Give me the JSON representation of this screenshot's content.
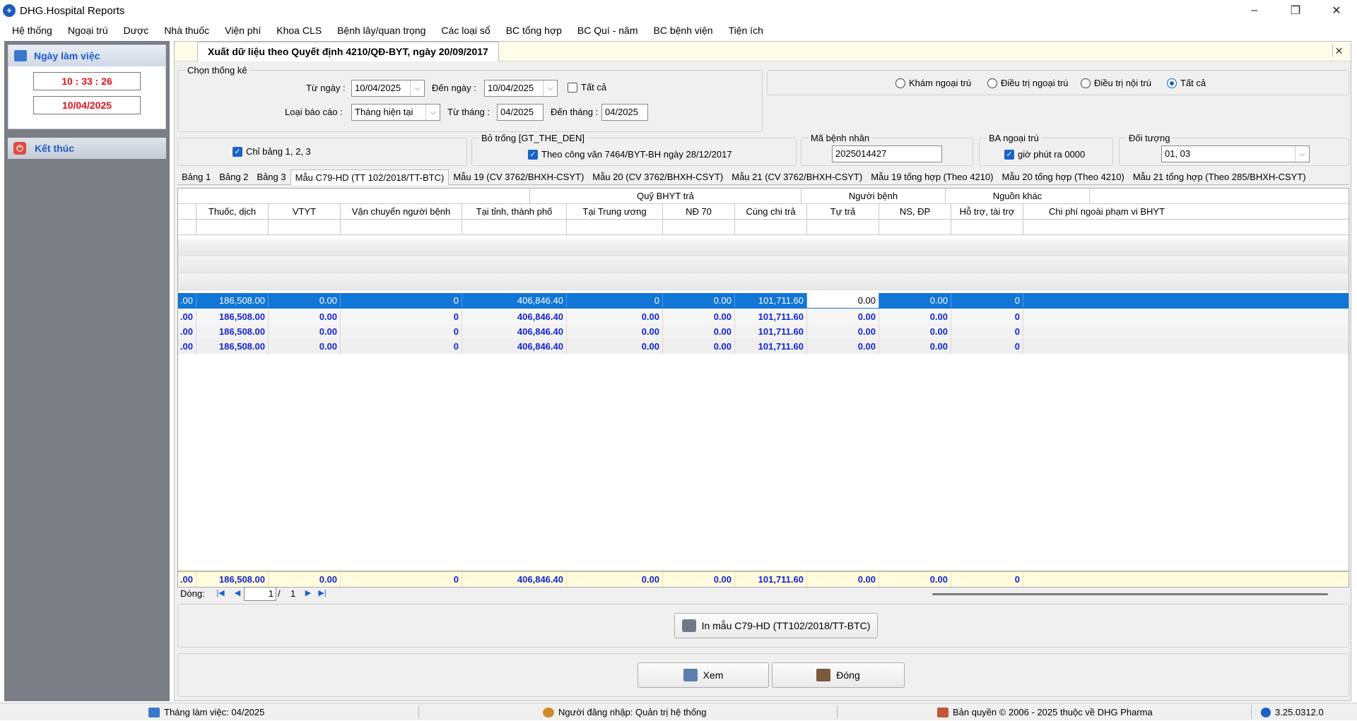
{
  "window": {
    "title": "DHG.Hospital Reports",
    "controls": [
      "–",
      "❐",
      "✕"
    ]
  },
  "menu": [
    "Hệ thống",
    "Ngoại trú",
    "Dược",
    "Nhà thuốc",
    "Viện phí",
    "Khoa CLS",
    "Bệnh lây/quan trọng",
    "Các loại sổ",
    "BC tổng hợp",
    "BC Quí - năm",
    "BC bệnh viện",
    "Tiện ích"
  ],
  "left": {
    "work_day_label": "Ngày làm việc",
    "time": "10 : 33 : 26",
    "date": "10/04/2025",
    "exit_label": "Kết thúc"
  },
  "doc": {
    "tab_title": "Xuất dữ liệu theo Quyết định 4210/QĐ-BYT, ngày 20/09/2017",
    "close": "✕"
  },
  "filters": {
    "group_label": "Chọn thống kê",
    "from_date_label": "Từ ngày :",
    "from_date": "10/04/2025",
    "to_date_label": "Đến ngày :",
    "to_date": "10/04/2025",
    "all_label": "Tất cả",
    "report_type_label": "Loại báo cáo :",
    "report_type": "Tháng hiện tại",
    "from_month_label": "Từ tháng :",
    "from_month": "04/2025",
    "to_month_label": "Đến tháng :",
    "to_month": "04/2025",
    "radios": [
      "Khám ngoại trú",
      "Điều trị ngoại trú",
      "Điều trị nội trú",
      "Tất cả"
    ],
    "only_tables_label": "Chỉ bảng 1, 2, 3",
    "blank_group_label": "Bỏ trống [GT_THE_DEN]",
    "blank_check_label": "Theo công văn 7464/BYT-BH ngày 28/12/2017",
    "patient_code_label": "Mã bệnh nhân",
    "patient_code": "2025014427",
    "ba_label": "BA ngoại trú",
    "ba_check_label": "giờ phút ra 0000",
    "object_label": "Đối tượng",
    "object_value": "01, 03"
  },
  "report_tabs": [
    "Bảng 1",
    "Bảng 2",
    "Bảng 3",
    "Mẫu C79-HD (TT 102/2018/TT-BTC)",
    "Mẫu 19 (CV 3762/BHXH-CSYT)",
    "Mẫu 20 (CV 3762/BHXH-CSYT)",
    "Mẫu 21 (CV 3762/BHXH-CSYT)",
    "Mẫu 19 tổng hợp (Theo 4210)",
    "Mẫu 20 tổng hợp (Theo 4210)",
    "Mẫu 21 tổng hợp (Theo 285/BHXH-CSYT)"
  ],
  "grid": {
    "group_headers": [
      "Quỹ BHYT trả",
      "Người bệnh",
      "Nguồn khác"
    ],
    "columns": [
      "Thuốc, dịch",
      "VTYT",
      "Vận chuyển người bệnh",
      "Tại tỉnh, thành phố",
      "Tại Trung ương",
      "NĐ 70",
      "Cùng chi trả",
      "Tự trả",
      "NS, ĐP",
      "Hỗ trợ, tài trợ",
      "Chi phí ngoài phạm vi BHYT"
    ],
    "selected_row": [
      ".00",
      "186,508.00",
      "0.00",
      "0",
      "406,846.40",
      "0",
      "0.00",
      "101,711.60",
      "0.00",
      "0.00",
      "0"
    ],
    "rows": [
      [
        ".00",
        "186,508.00",
        "0.00",
        "0",
        "406,846.40",
        "0.00",
        "0.00",
        "101,711.60",
        "0.00",
        "0.00",
        "0"
      ],
      [
        ".00",
        "186,508.00",
        "0.00",
        "0",
        "406,846.40",
        "0.00",
        "0.00",
        "101,711.60",
        "0.00",
        "0.00",
        "0"
      ],
      [
        ".00",
        "186,508.00",
        "0.00",
        "0",
        "406,846.40",
        "0.00",
        "0.00",
        "101,711.60",
        "0.00",
        "0.00",
        "0"
      ]
    ],
    "summary": [
      ".00",
      "186,508.00",
      "0.00",
      "0",
      "406,846.40",
      "0.00",
      "0.00",
      "101,711.60",
      "0.00",
      "0.00",
      "0"
    ]
  },
  "pager": {
    "label": "Dòng:",
    "current": "1",
    "separator": "/",
    "total": "1"
  },
  "buttons": {
    "print": "In mẫu C79-HD (TT102/2018/TT-BTC)",
    "view": "Xem",
    "close": "Đóng"
  },
  "status": {
    "month": "Tháng làm việc: 04/2025",
    "user": "Người đăng nhập: Quản trị hệ thống",
    "copyright": "Bản quyền © 2006 - 2025 thuộc về DHG Pharma",
    "version": "3.25.0312.0"
  }
}
